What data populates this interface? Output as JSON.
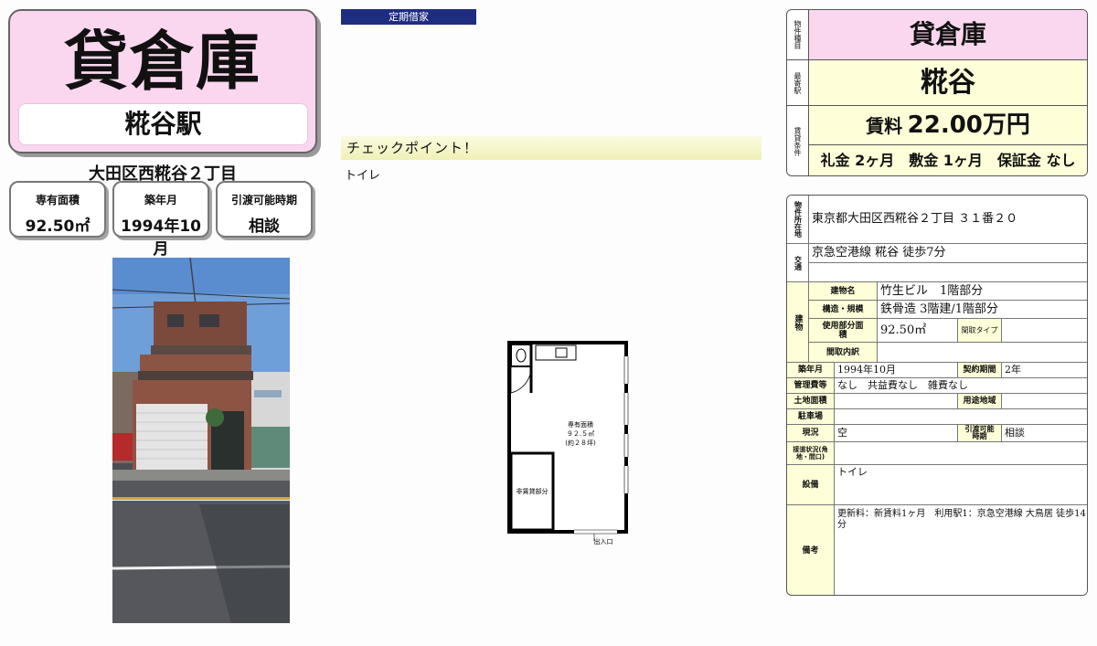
{
  "left": {
    "type": "貸倉庫",
    "station": "糀谷駅",
    "address": "大田区西糀谷２丁目",
    "boxes": [
      {
        "label": "専有面積",
        "value": "92.50㎡"
      },
      {
        "label": "築年月",
        "value": "1994年10月"
      },
      {
        "label": "引渡可能時期",
        "value": "相談"
      }
    ]
  },
  "middle": {
    "badge": "定期借家",
    "checkpoint_title": "チェックポイント！",
    "checkpoint_text": "トイレ",
    "plan": {
      "area_label": "専有面積",
      "area_value": "９２.５㎡",
      "area_tsubo": "(約２８坪)",
      "non_rental": "非賃貸部分",
      "entrance": "出入口"
    }
  },
  "summary": {
    "type_label": "物件種目",
    "type": "貸倉庫",
    "station_label": "最寄駅",
    "station": "糀谷",
    "terms_label": "賃貸条件",
    "rent_prefix": "賃料",
    "rent": "22.00万円",
    "deposits": "礼金 2ヶ月　敷金 1ヶ月　保証金 なし"
  },
  "details": {
    "location_label": "物件所在地",
    "location": "東京都大田区西糀谷２丁目 ３１番２０",
    "transport_label": "交通",
    "transport": "京急空港線 糀谷 徒歩7分",
    "building_label": "建物",
    "name_label": "建物名",
    "name": "竹生ビル　1階部分",
    "structure_label": "構造・規模",
    "structure": "鉄骨造 3階建/1階部分",
    "area_label": "使用部分面積",
    "area": "92.50㎡",
    "layout_type_label": "間取タイプ",
    "layout_label": "間取内訳",
    "built_label": "築年月",
    "built": "1994年10月",
    "contract_label": "契約期間",
    "contract": "2年",
    "fee_label": "管理費等",
    "fee": "なし　共益費なし　雑費なし",
    "land_label": "土地面積",
    "zoning_label": "用途地域",
    "parking_label": "駐車場",
    "status_label": "現況",
    "status": "空",
    "handover_label": "引渡可能時期",
    "handover": "相談",
    "road_label": "接道状況(角地・間口)",
    "facilities_label": "設備",
    "facilities": "トイレ",
    "remarks_label": "備考",
    "remarks_1": "更新料：新賃料1ヶ月　利用駅1：京急空港線 大鳥居 徒歩14",
    "remarks_2": "分"
  }
}
